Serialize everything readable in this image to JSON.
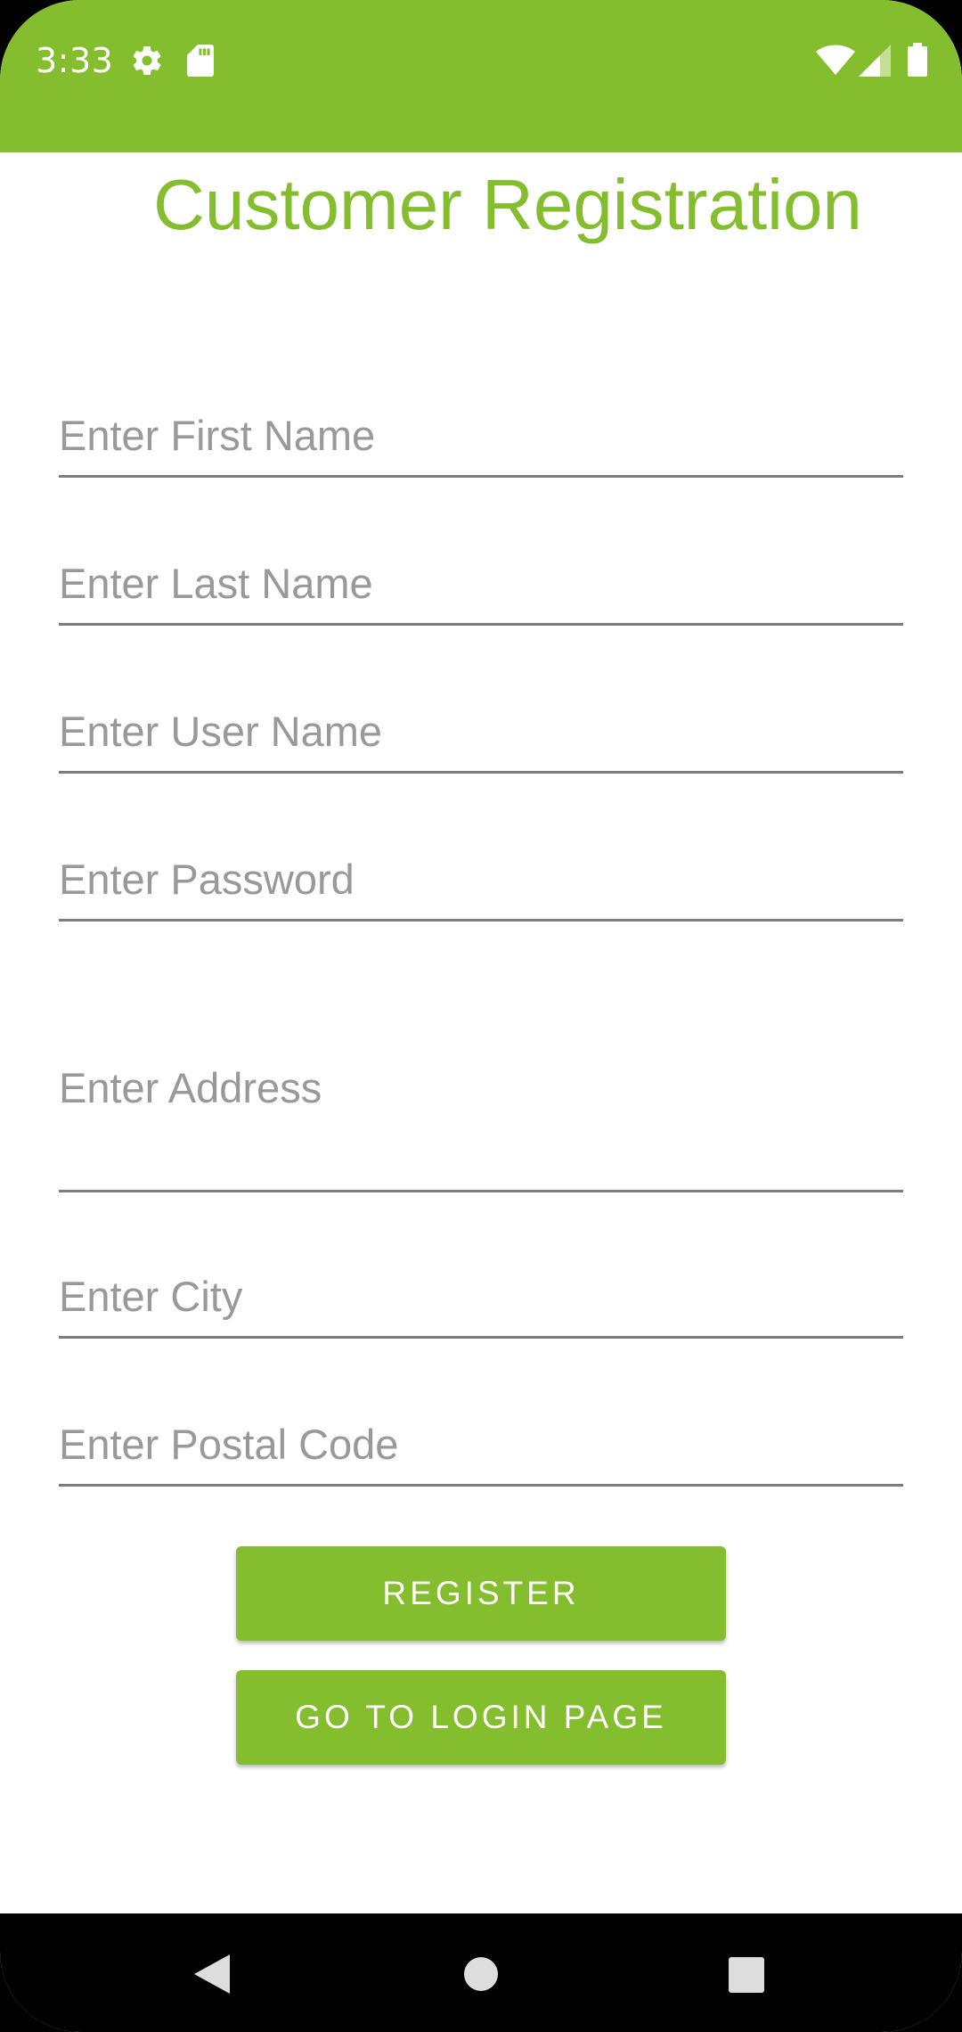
{
  "status_bar": {
    "time": "3:33",
    "icons": [
      "gear-icon",
      "sd-card-icon",
      "wifi-icon",
      "signal-icon",
      "battery-icon"
    ],
    "background": "#84bd2e"
  },
  "page": {
    "title": "Customer Registration",
    "accent_color": "#84bd2e"
  },
  "form": {
    "first_name": {
      "placeholder": "Enter First Name",
      "value": ""
    },
    "last_name": {
      "placeholder": "Enter Last Name",
      "value": ""
    },
    "user_name": {
      "placeholder": "Enter User Name",
      "value": ""
    },
    "password": {
      "placeholder": "Enter Password",
      "value": ""
    },
    "address": {
      "placeholder": "Enter Address",
      "value": ""
    },
    "city": {
      "placeholder": "Enter City",
      "value": ""
    },
    "postal_code": {
      "placeholder": "Enter Postal Code",
      "value": ""
    }
  },
  "buttons": {
    "register": "REGISTER",
    "go_to_login": "GO TO LOGIN PAGE"
  },
  "nav_bar": {
    "icons": [
      "back-icon",
      "home-icon",
      "recents-icon"
    ]
  }
}
